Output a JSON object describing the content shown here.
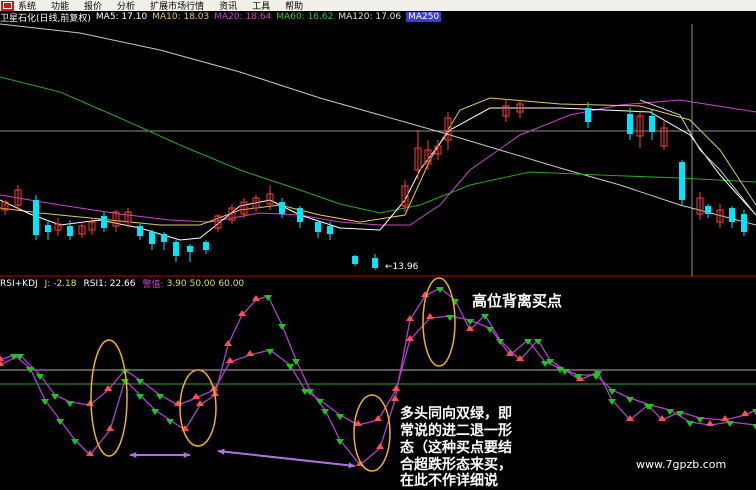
{
  "menu": {
    "items": [
      "系统",
      "功能",
      "报价",
      "分析",
      "扩展市场行情",
      "资讯",
      "工具",
      "帮助"
    ]
  },
  "kline": {
    "stock_name": "卫星石化(日线,前复权)",
    "ma5": "MA5: 17.10",
    "ma10": "MA10: 18.03",
    "ma20": "MA20: 18.64",
    "ma60": "MA60: 16.62",
    "ma120": "MA120: 17.06",
    "ma250": "MA250",
    "low_label": "←13.96"
  },
  "indicator": {
    "name": "RSI+KDJ",
    "j": "J: -2.18",
    "rsi1": "RSI1: 22.66",
    "threshold_label": "警值:",
    "v1": "3.90",
    "v2": "50.00",
    "v3": "60.00"
  },
  "annotations": {
    "top": "高位背离买点",
    "lines": [
      "多头同向双绿，即",
      "常说的进二退一形",
      "态（这种买点要结",
      "合超跌形态来买，",
      "在此不作详细说"
    ],
    "watermark": "www.7gpzb.com"
  },
  "colors": {
    "up": "#ff3c3c",
    "down": "#00e5ff",
    "ma5": "#ffffff",
    "ma10": "#e6c85a",
    "ma20": "#cc44cc",
    "ma60": "#22aa22",
    "ma120": "#d4a94f",
    "rsi_line": "#b040d0",
    "highlight_ellipse": "#f0b020",
    "arrow": "#b070e0",
    "green_marker": "#19c819",
    "red_marker": "#ff5050"
  }
}
